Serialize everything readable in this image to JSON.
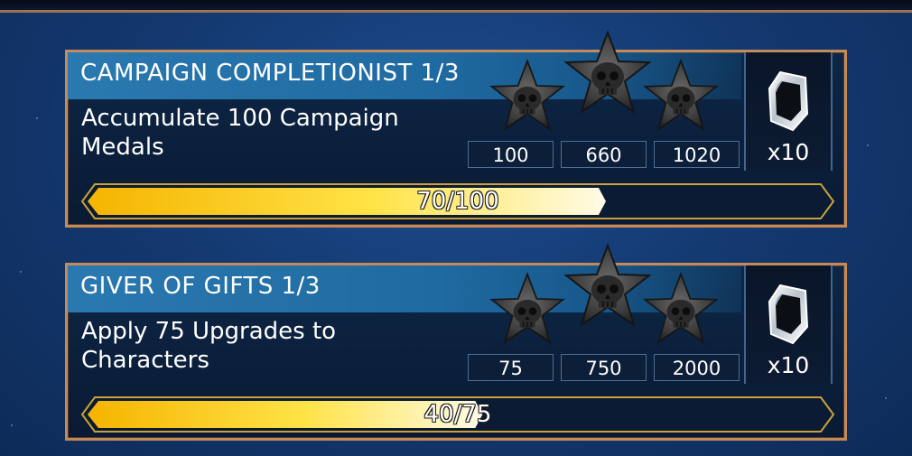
{
  "achievements": [
    {
      "title": "CAMPAIGN COMPLETIONIST 1/3",
      "description": "Accumulate 100 Campaign Medals",
      "tiers": [
        "100",
        "660",
        "1020"
      ],
      "reward": {
        "icon": "crystal-icon",
        "count": "x10"
      },
      "progress": {
        "text": "70/100",
        "current": 70,
        "goal": 100
      }
    },
    {
      "title": "GIVER OF GIFTS 1/3",
      "description": "Apply 75 Upgrades to Characters",
      "tiers": [
        "75",
        "750",
        "2000"
      ],
      "reward": {
        "icon": "crystal-icon",
        "count": "x10"
      },
      "progress": {
        "text": "40/75",
        "current": 40,
        "goal": 75
      }
    }
  ],
  "colors": {
    "card_border": "#c48a5a",
    "title_band": "#2a79b0",
    "bar_fill_start": "#f5b400",
    "bar_fill_end": "#fffbe6",
    "bar_border": "#c9a23a"
  }
}
